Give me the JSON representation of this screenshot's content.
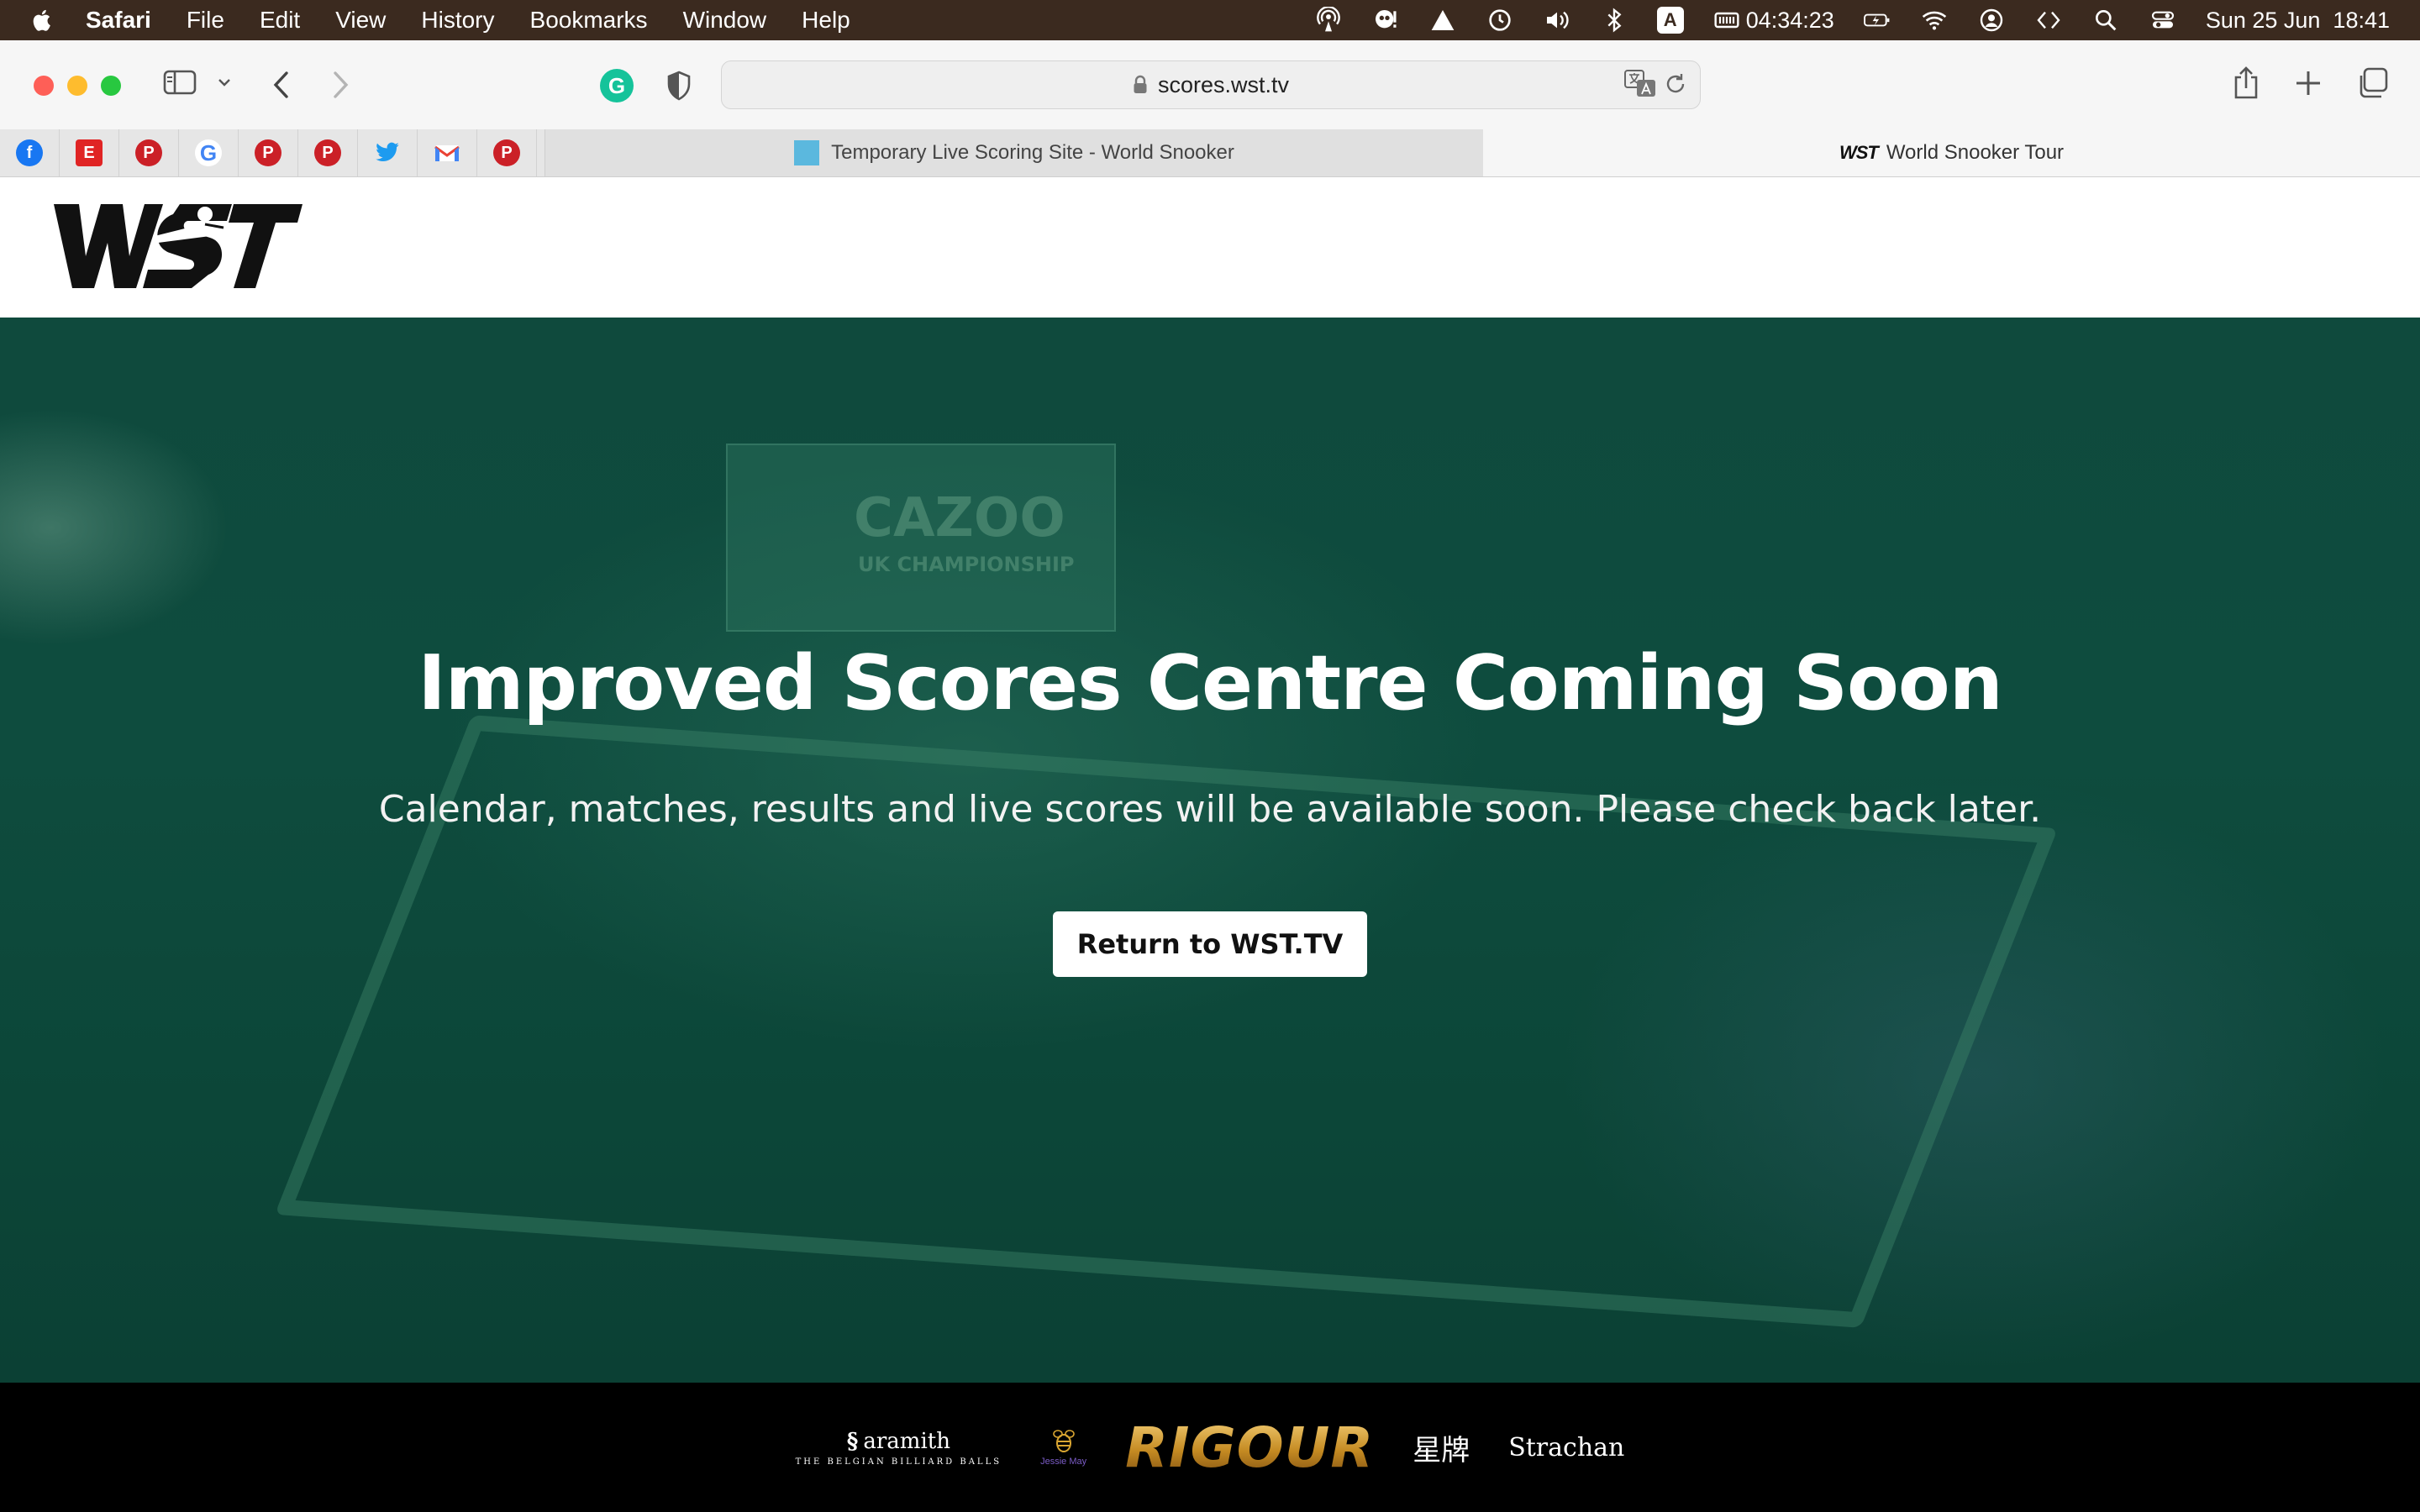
{
  "menubar": {
    "app": "Safari",
    "items": [
      "File",
      "Edit",
      "View",
      "History",
      "Bookmarks",
      "Window",
      "Help"
    ],
    "ime": "A",
    "timer": "04:34:23",
    "datetime": "Sun 25 Jun  18:41"
  },
  "browser": {
    "url": "scores.wst.tv",
    "favorites": [
      {
        "name": "facebook",
        "color": "#1877f2",
        "glyph": "f"
      },
      {
        "name": "e-app",
        "color": "#e02424",
        "glyph": "E"
      },
      {
        "name": "pinterest",
        "color": "#cb2027",
        "glyph": "P"
      },
      {
        "name": "google",
        "color": "#4285f4",
        "glyph": "G"
      },
      {
        "name": "pinterest",
        "color": "#cb2027",
        "glyph": "P"
      },
      {
        "name": "pinterest",
        "color": "#cb2027",
        "glyph": "P"
      },
      {
        "name": "twitter",
        "color": "#1d9bf0",
        "glyph": "t"
      },
      {
        "name": "gmail",
        "color": "#ea4335",
        "glyph": "M"
      },
      {
        "name": "pinterest",
        "color": "#cb2027",
        "glyph": "P"
      }
    ],
    "tabs": [
      {
        "title": "Temporary Live Scoring Site - World Snooker",
        "active": false
      },
      {
        "title": "World Snooker Tour",
        "active": true,
        "mini_logo": "WST"
      }
    ]
  },
  "site": {
    "logo_text": "WST",
    "hero": {
      "title": "Improved Scores Centre Coming Soon",
      "subtitle": "Calendar, matches, results and live scores will be available soon. Please check back later.",
      "button_label": "Return to WST.TV",
      "background_sign_text": "CAZOO",
      "background_sign_sub": "UK CHAMPIONSHIP"
    },
    "sponsors": {
      "aramith": "aramith",
      "aramith_tagline": "THE BELGIAN BILLIARD BALLS",
      "jessie_may": "Jessie May",
      "rigour": "RIGOUR",
      "xingpai": "星牌",
      "strachan": "Strachan"
    }
  },
  "colors": {
    "menubar": "#3b2a1f",
    "hero_green": "#0f4a3d",
    "sponsor_bar": "#000000",
    "button_bg": "#ffffff"
  }
}
